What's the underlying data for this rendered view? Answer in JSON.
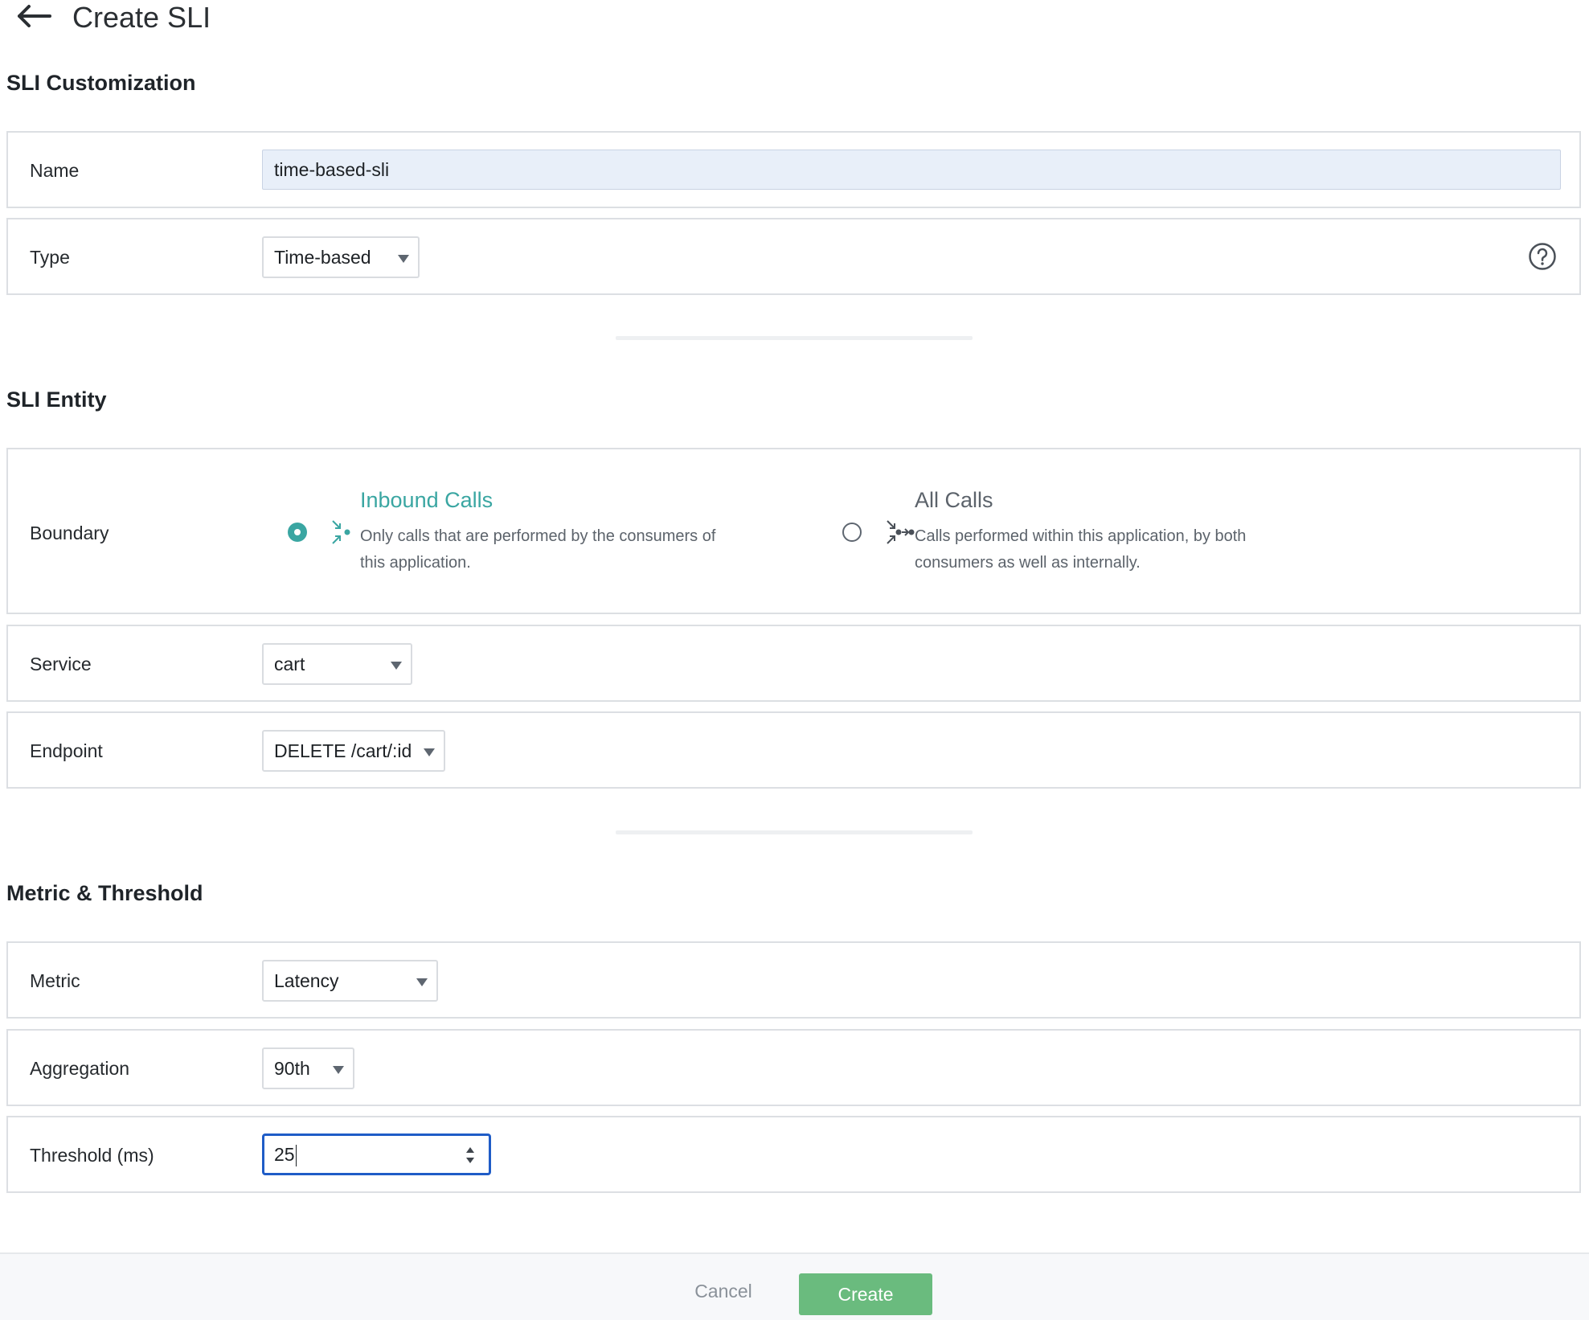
{
  "header": {
    "title": "Create SLI",
    "back_icon": "arrow-left-icon"
  },
  "sections": {
    "customization_title": "SLI Customization",
    "entity_title": "SLI Entity",
    "metric_title": "Metric & Threshold"
  },
  "customization": {
    "name_label": "Name",
    "name_value": "time-based-sli",
    "type_label": "Type",
    "type_value": "Time-based",
    "help_icon": "question-circle-icon"
  },
  "entity": {
    "boundary_label": "Boundary",
    "options": [
      {
        "title": "Inbound Calls",
        "desc_line1": "Only calls that are performed by the consumers of",
        "desc_line2": "this application.",
        "selected": true,
        "icon": "inbound-calls-icon",
        "color": "#3aa6a2"
      },
      {
        "title": "All Calls",
        "desc_line1": "Calls performed within this application, by both",
        "desc_line2": "consumers as well as internally.",
        "selected": false,
        "icon": "all-calls-icon",
        "color": "#5c636b"
      }
    ],
    "service_label": "Service",
    "service_value": "cart",
    "endpoint_label": "Endpoint",
    "endpoint_value": "DELETE /cart/:id"
  },
  "metric": {
    "metric_label": "Metric",
    "metric_value": "Latency",
    "aggregation_label": "Aggregation",
    "aggregation_value": "90th",
    "threshold_label": "Threshold (ms)",
    "threshold_value": "25"
  },
  "footer": {
    "cancel_label": "Cancel",
    "create_label": "Create"
  },
  "colors": {
    "accent": "#3aa6a2",
    "primary_button": "#6abb7e",
    "focus_border": "#1f5cc7"
  }
}
